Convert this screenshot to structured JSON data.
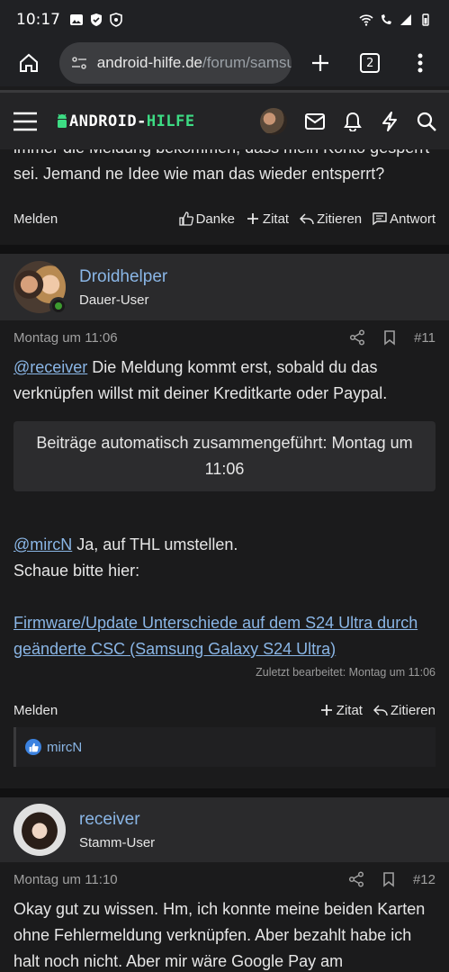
{
  "status": {
    "time": "10:17"
  },
  "browser": {
    "url_host": "android-hilfe.de",
    "url_path": "/forum/samsung",
    "tab_count": "2"
  },
  "site": {
    "logo_left": "ANDROID-",
    "logo_right": "HILFE"
  },
  "prev_post": {
    "text": "immer die Meldung bekommen, dass mein Konto gesperrt sei. Jemand ne Idee wie man das wieder entsperrt?",
    "report": "Melden",
    "actions": [
      "Danke",
      "Zitat",
      "Zitieren",
      "Antwort"
    ]
  },
  "post11": {
    "author": "Droidhelper",
    "role": "Dauer-User",
    "date": "Montag um 11:06",
    "number": "#11",
    "mention1": "@receiver",
    "text1": " Die Meldung kommt erst, sobald du das verknüpfen willst mit deiner Kreditkarte oder Paypal.",
    "merge_notice": "Beiträge automatisch zusammengeführt: Montag um 11:06",
    "mention2": "@mircN",
    "text2": " Ja, auf THL umstellen.",
    "text3": "Schaue bitte hier:",
    "link": "Firmware/Update Unterschiede auf dem S24 Ultra durch geänderte CSC (Samsung Galaxy S24 Ultra)",
    "edited": "Zuletzt bearbeitet: Montag um 11:06",
    "report": "Melden",
    "actions": [
      "Zitat",
      "Zitieren"
    ],
    "reaction_user": "mircN"
  },
  "post12": {
    "author": "receiver",
    "role": "Stamm-User",
    "date": "Montag um 11:10",
    "number": "#12",
    "text": "Okay gut zu wissen. Hm, ich konnte meine beiden Karten ohne Fehlermeldung verknüpfen. Aber bezahlt habe ich halt noch nicht. Aber mir wäre Google Pay am"
  }
}
